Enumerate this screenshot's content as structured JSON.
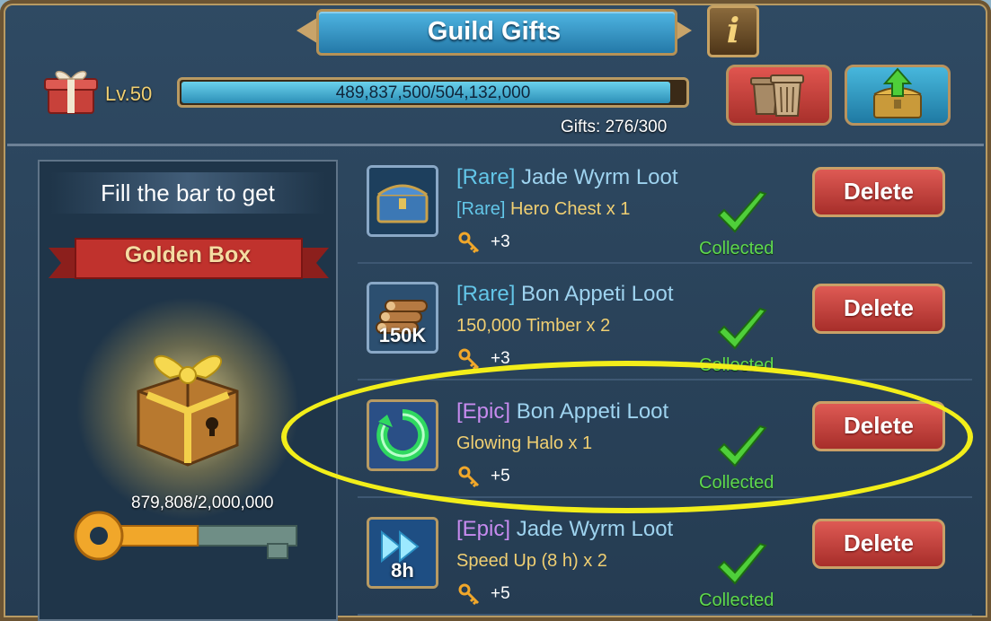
{
  "header": {
    "title": "Guild Gifts",
    "info_label": "i",
    "level": "Lv.50",
    "xp_text": "489,837,500/504,132,000",
    "xp_fraction": 0.9716,
    "gifts_text": "Gifts: 276/300"
  },
  "buttons": {
    "trash_icon": "trash-bins-icon",
    "upload_icon": "chest-upload-icon"
  },
  "left_panel": {
    "fill_text": "Fill the bar to get",
    "reward_name": "Golden Box",
    "key_progress": "879,808/2,000,000",
    "key_fraction": 0.44
  },
  "gifts": [
    {
      "tier": "[Rare]",
      "tier_class": "rare",
      "name": " Jade Wyrm Loot",
      "sub_tier": "[Rare]",
      "sub_name": " Hero Chest x 1",
      "keys": "+3",
      "status": "Collected",
      "delete": "Delete",
      "icon": "hero-chest-icon",
      "badge": ""
    },
    {
      "tier": "[Rare]",
      "tier_class": "rare",
      "name": " Bon Appeti Loot",
      "sub_tier": "",
      "sub_name": "150,000 Timber x 2",
      "keys": "+3",
      "status": "Collected",
      "delete": "Delete",
      "icon": "timber-icon",
      "badge": "150K"
    },
    {
      "tier": "[Epic]",
      "tier_class": "epic",
      "name": " Bon Appeti Loot",
      "sub_tier": "",
      "sub_name": "Glowing Halo x 1",
      "keys": "+5",
      "status": "Collected",
      "delete": "Delete",
      "icon": "glowing-halo-icon",
      "badge": ""
    },
    {
      "tier": "[Epic]",
      "tier_class": "epic",
      "name": " Jade Wyrm Loot",
      "sub_tier": "",
      "sub_name": "Speed Up (8 h) x 2",
      "keys": "+5",
      "status": "Collected",
      "delete": "Delete",
      "icon": "speed-up-icon",
      "badge": "8h"
    }
  ],
  "colors": {
    "highlight": "#f2ee1a",
    "collected": "#5fd84f",
    "rare": "#63c6e8",
    "epic": "#c78bef"
  }
}
